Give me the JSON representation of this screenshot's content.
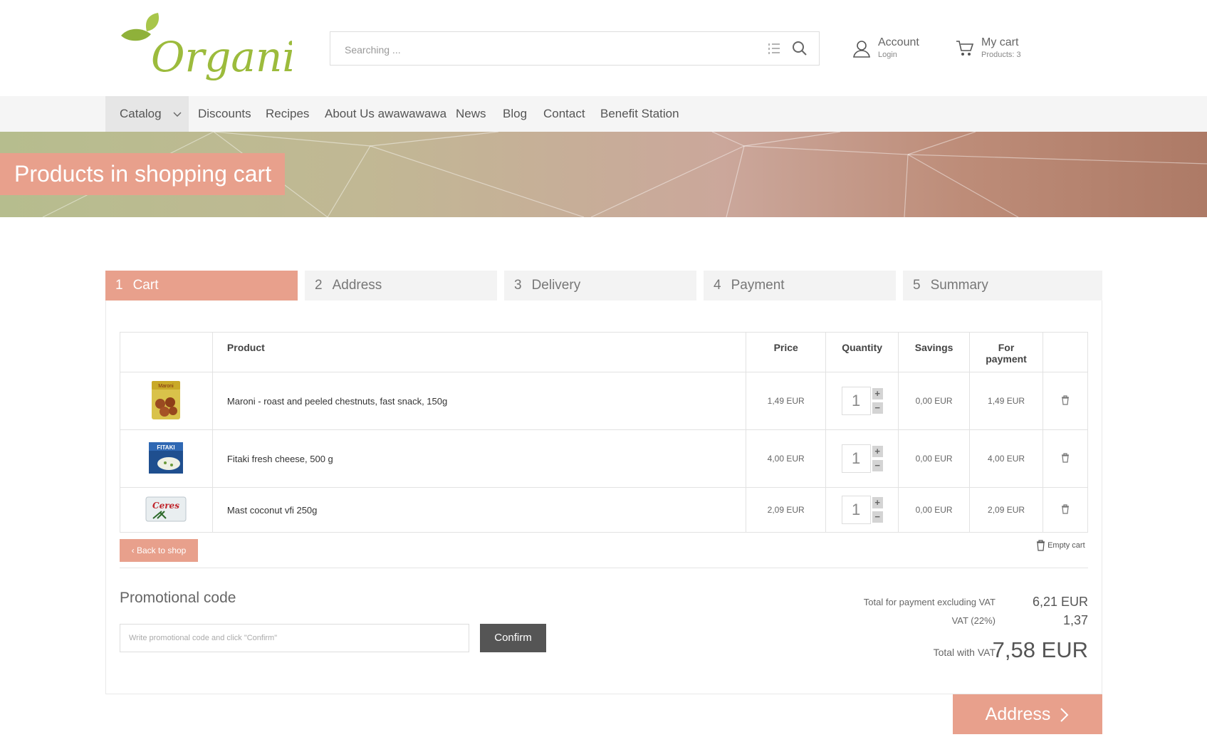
{
  "header": {
    "logo_text": "Organica",
    "search": {
      "placeholder": "Searching ..."
    },
    "account": {
      "label": "Account",
      "sub": "Login"
    },
    "cart": {
      "label": "My cart",
      "sub": "Products: 3"
    }
  },
  "nav": {
    "items": [
      "Catalog",
      "Discounts",
      "Recipes",
      "About Us awawawawa",
      "News",
      "Blog",
      "Contact",
      "Benefit Station"
    ]
  },
  "banner": {
    "title": "Products in shopping cart"
  },
  "steps": [
    {
      "num": "1",
      "label": "Cart",
      "active": true
    },
    {
      "num": "2",
      "label": "Address"
    },
    {
      "num": "3",
      "label": "Delivery"
    },
    {
      "num": "4",
      "label": "Payment"
    },
    {
      "num": "5",
      "label": "Summary"
    }
  ],
  "table": {
    "headers": {
      "product": "Product",
      "price": "Price",
      "quantity": "Quantity",
      "savings": "Savings",
      "payment_line1": "For",
      "payment_line2": "payment"
    },
    "rows": [
      {
        "product": "Maroni - roast and peeled chestnuts, fast snack, 150g",
        "price": "1,49 EUR",
        "quantity": "1",
        "savings": "0,00 EUR",
        "payment": "1,49 EUR",
        "image_label": "Maroni"
      },
      {
        "product": "Fitaki fresh cheese, 500 g",
        "price": "4,00 EUR",
        "quantity": "1",
        "savings": "0,00 EUR",
        "payment": "4,00 EUR",
        "image_label": "FITAKI"
      },
      {
        "product": "Mast coconut vfi 250g",
        "price": "2,09 EUR",
        "quantity": "1",
        "savings": "0,00 EUR",
        "payment": "2,09 EUR",
        "image_label": "Ceres"
      }
    ]
  },
  "actions": {
    "back": "Back to shop",
    "empty_cart": "Empty cart",
    "next": "Address"
  },
  "promo": {
    "title": "Promotional code",
    "placeholder": "Write promotional code and click \"Confirm\"",
    "confirm": "Confirm"
  },
  "totals": {
    "excl_vat_label": "Total for payment excluding VAT",
    "excl_vat_value": "6,21 EUR",
    "vat_label": "VAT (22%)",
    "vat_value": "1,37",
    "total_label": "Total with VAT",
    "total_value": "7,58 EUR"
  },
  "colors": {
    "accent": "#e8a08c",
    "brand_green": "#9cbb3c",
    "dark_button": "#555555"
  }
}
